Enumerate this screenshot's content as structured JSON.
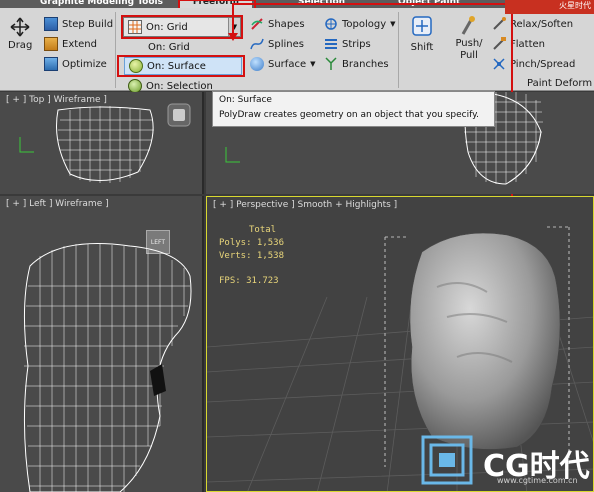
{
  "tabs": [
    {
      "label": "Graphite Modeling Tools"
    },
    {
      "label": "Freeform"
    },
    {
      "label": "Selection"
    },
    {
      "label": "Object Paint"
    }
  ],
  "ribbon": {
    "drag_label": "Drag",
    "step_build": "Step Build",
    "extend": "Extend",
    "optimize": "Optimize",
    "dropdown_current": "On: Grid",
    "dropdown_options": [
      "On: Grid",
      "On: Surface",
      "On: Selection"
    ],
    "shapes": "Shapes",
    "splines": "Splines",
    "surface": "Surface",
    "topology": "Topology",
    "strips": "Strips",
    "branches": "Branches",
    "shift": "Shift",
    "push_pull": "Push/\nPull",
    "relax_soften": "Relax/Soften",
    "flatten": "Flatten",
    "pinch_spread": "Pinch/Spread",
    "paint_deform": "Paint Deform"
  },
  "tooltip": {
    "title": "On: Surface",
    "body": "PolyDraw creates geometry on an object that you specify."
  },
  "viewports": {
    "top": {
      "label": "[ + ] Top ] Wireframe ]"
    },
    "left": {
      "label": "[ + ] Left ] Wireframe ]"
    },
    "persp": {
      "label": "[ + ] Perspective ] Smooth + Highlights ]"
    },
    "left_cube": "LEFT"
  },
  "stats": {
    "total": "Total",
    "polys": "Polys: 1,536",
    "verts": "Verts: 1,538",
    "fps": "FPS:   31.723"
  },
  "watermark": {
    "text": "CG时代",
    "url": "www.cgtime.com.cn",
    "top_text": "火星时代"
  },
  "colors": {
    "highlight_red": "#d41010",
    "stats_yellow": "#e8d57a",
    "viewport_bg": "#4a4a4a",
    "ribbon_bg": "#d6d6d6"
  }
}
